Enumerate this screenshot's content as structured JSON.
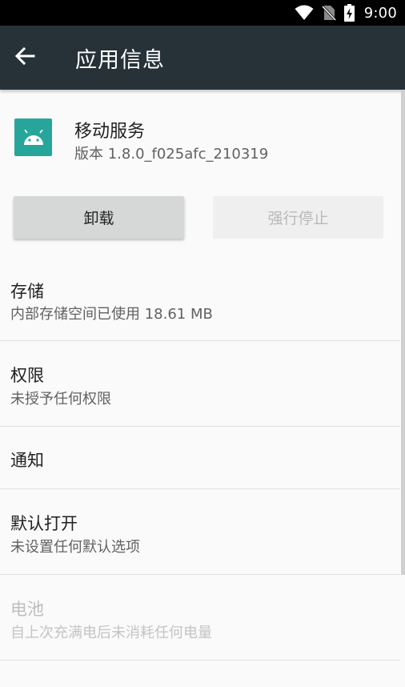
{
  "status_bar": {
    "time": "9:00",
    "icons": [
      "wifi-icon",
      "no-sim-icon",
      "battery-charging-icon"
    ]
  },
  "toolbar": {
    "title": "应用信息",
    "back_icon": "arrow-back-icon",
    "color": "#263238"
  },
  "app": {
    "name": "移动服务",
    "version": "版本 1.8.0_f025afc_210319",
    "icon": "android-icon",
    "icon_color": "#26a69a"
  },
  "buttons": {
    "uninstall": "卸载",
    "force_stop": "强行停止"
  },
  "settings": {
    "storage": {
      "title": "存储",
      "summary": "内部存储空间已使用 18.61 MB"
    },
    "permissions": {
      "title": "权限",
      "summary": "未授予任何权限"
    },
    "notifications": {
      "title": "通知"
    },
    "open_by_default": {
      "title": "默认打开",
      "summary": "未设置任何默认选项"
    },
    "battery": {
      "title": "电池",
      "summary": "自上次充满电后未消耗任何电量"
    }
  }
}
